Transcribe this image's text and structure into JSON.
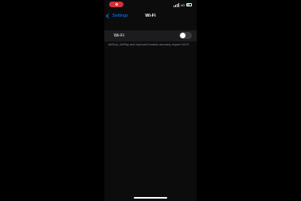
{
  "status_bar": {
    "network": "4G",
    "battery_level": 0.6,
    "recording": true
  },
  "nav": {
    "back_label": "Settings",
    "title": "Wi-Fi"
  },
  "wifi": {
    "label": "Wi-Fi",
    "enabled": false
  },
  "footnote": "AirDrop, AirPlay and improved location accuracy require Wi-Fi.",
  "colors": {
    "accent": "#0a84ff",
    "recording": "#d2323c",
    "toggle_off": "#39393d",
    "battery": "#34c759"
  }
}
